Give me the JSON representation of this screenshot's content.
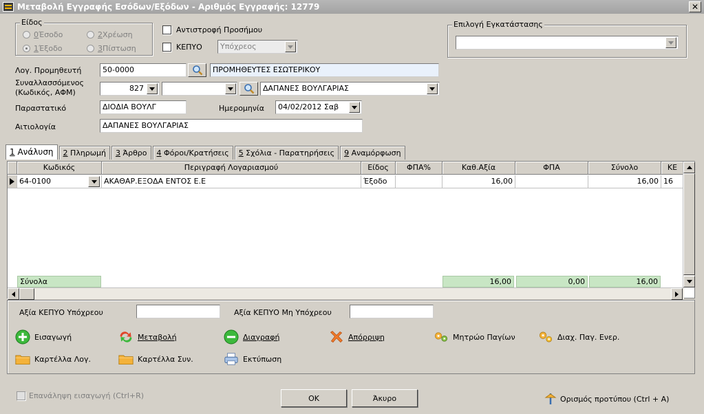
{
  "window": {
    "title": "Μεταβολή Εγγραφής Εσόδων/Εξόδων - Αριθμός Εγγραφής: 12779",
    "close_label": "✕"
  },
  "eidos": {
    "legend": "Είδος",
    "options": [
      {
        "key": "0",
        "label": " Έσοδο",
        "selected": false
      },
      {
        "key": "2",
        "label": " Χρέωση",
        "selected": false
      },
      {
        "key": "1",
        "label": " Έξοδο",
        "selected": true
      },
      {
        "key": "3",
        "label": " Πίστωση",
        "selected": false
      }
    ]
  },
  "antistrofi": {
    "label": "Αντιστροφή Προσήμου"
  },
  "kepyo": {
    "label": "ΚΕΠΥΟ",
    "value": "Υπόχρεος"
  },
  "epilogi": {
    "legend": "Επιλογή Εγκατάστασης",
    "value": ""
  },
  "form": {
    "log_prom_label": "Λογ. Προμηθευτή",
    "log_prom_code": "50-0000",
    "log_prom_name": "ΠΡΟΜΗΘΕΥΤΕΣ ΕΣΩΤΕΡΙΚΟΥ",
    "synal_label_1": "Συναλλασσόμενος",
    "synal_label_2": "(Κωδικός, ΑΦΜ)",
    "synal_code": "827",
    "synal_afm": "",
    "synal_name": "ΔΑΠΑΝΕΣ ΒΟΥΛΓΑΡΙΑΣ",
    "parastatiko_label": "Παραστατικό",
    "parastatiko": "ΔΙΟΔΙΑ ΒΟΥΛΓ",
    "imerominia_label": "Ημερομηνία",
    "imerominia": "04/02/2012 Σαβ",
    "aitiologia_label": "Αιτιολογία",
    "aitiologia": "ΔΑΠΑΝΕΣ ΒΟΥΛΓΑΡΙΑΣ"
  },
  "tabs": [
    {
      "key": "1",
      "label": " Ανάλυση",
      "active": true
    },
    {
      "key": "2",
      "label": " Πληρωμή",
      "active": false
    },
    {
      "key": "3",
      "label": " Άρθρο",
      "active": false
    },
    {
      "key": "4",
      "label": " Φόροι/Κρατήσεις",
      "active": false
    },
    {
      "key": "5",
      "label": " Σχόλια - Παρατηρήσεις",
      "active": false
    },
    {
      "key": "9",
      "label": " Αναμόρφωση",
      "active": false
    }
  ],
  "grid": {
    "columns": [
      "Κωδικός",
      "Περιγραφή Λογαριασμού",
      "Είδος",
      "ΦΠΑ%",
      "Καθ.Αξία",
      "ΦΠΑ",
      "Σύνολο",
      "ΚΕ"
    ],
    "rows": [
      {
        "code": "64-0100",
        "desc": "ΑΚΑΘΑΡ.ΕΞΟΔΑ ΕΝΤΟΣ Ε.Ε",
        "eidos": "Έξοδο",
        "fpa_pct": "",
        "kath": "16,00",
        "fpa": "",
        "synolo": "16,00",
        "ke": "16"
      }
    ],
    "totals": {
      "label": "Σύνολα",
      "kath": "16,00",
      "fpa": "0,00",
      "synolo": "16,00"
    }
  },
  "kepyo_values": {
    "ypoxreou_label": "Αξία ΚΕΠΥΟ Υπόχρεου",
    "ypoxreou": "",
    "mi_ypoxreou_label": "Αξία ΚΕΠΥΟ Μη Υπόχρεου",
    "mi_ypoxreou": ""
  },
  "actions": {
    "eisagogi": "Εισαγωγή",
    "metavoli": "Μεταβολή",
    "diagrafi": "Διαγραφή",
    "aporripsi": "Απόρριψη",
    "mitroo": "Μητρώο Παγίων",
    "diax": "Διαχ. Παγ. Ενερ.",
    "kartella_log": "Καρτέλλα Λογ.",
    "kartella_syn": "Καρτέλλα Συν.",
    "ektyposi": "Εκτύπωση"
  },
  "bottom": {
    "epanalipsi": "Επανάληψη εισαγωγή (Ctrl+R)",
    "ok": "OK",
    "akyro": "Άκυρο",
    "protypo": "Ορισμός προτύπου (Ctrl + A)"
  },
  "colors": {
    "accent_green": "#3cb83c",
    "totals_bg": "#c8e6c4",
    "folder": "#f4b23a"
  }
}
